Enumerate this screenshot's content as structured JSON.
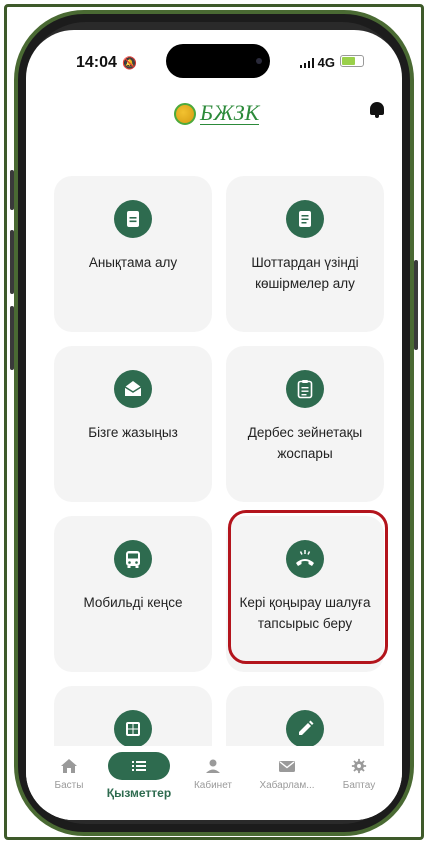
{
  "status_bar": {
    "time": "14:04",
    "network": "4G",
    "signal_icon": "signal-bars-icon",
    "battery_icon": "battery-charging-icon"
  },
  "header": {
    "logo_text": "БЖЗК",
    "notification_icon": "bell-icon"
  },
  "services": [
    {
      "label": "Анықтама алу",
      "icon": "document-icon"
    },
    {
      "label": "Шоттардан үзінді көшірмелер алу",
      "icon": "document-lines-icon"
    },
    {
      "label": "Бізге жазыңыз",
      "icon": "envelope-open-icon"
    },
    {
      "label": "Дербес зейнетақы жоспары",
      "icon": "clipboard-icon"
    },
    {
      "label": "Мобильді кеңсе",
      "icon": "bus-icon"
    },
    {
      "label": "Кері қоңырау шалуға тапсырыс беру",
      "icon": "phone-callback-icon",
      "highlighted": true
    },
    {
      "label": "",
      "icon": "calculator-icon"
    },
    {
      "label": "",
      "icon": "pencil-icon"
    }
  ],
  "bottom_nav": [
    {
      "label": "Басты",
      "icon": "home-icon",
      "active": false
    },
    {
      "label": "Қызметтер",
      "icon": "list-icon",
      "active": true
    },
    {
      "label": "Кабинет",
      "icon": "user-icon",
      "active": false
    },
    {
      "label": "Хабарлам...",
      "icon": "mail-icon",
      "active": false
    },
    {
      "label": "Баптау",
      "icon": "gear-icon",
      "active": false
    }
  ],
  "colors": {
    "accent": "#2e6b4f",
    "highlight_border": "#b3141c",
    "card_bg": "#f4f4f4"
  }
}
